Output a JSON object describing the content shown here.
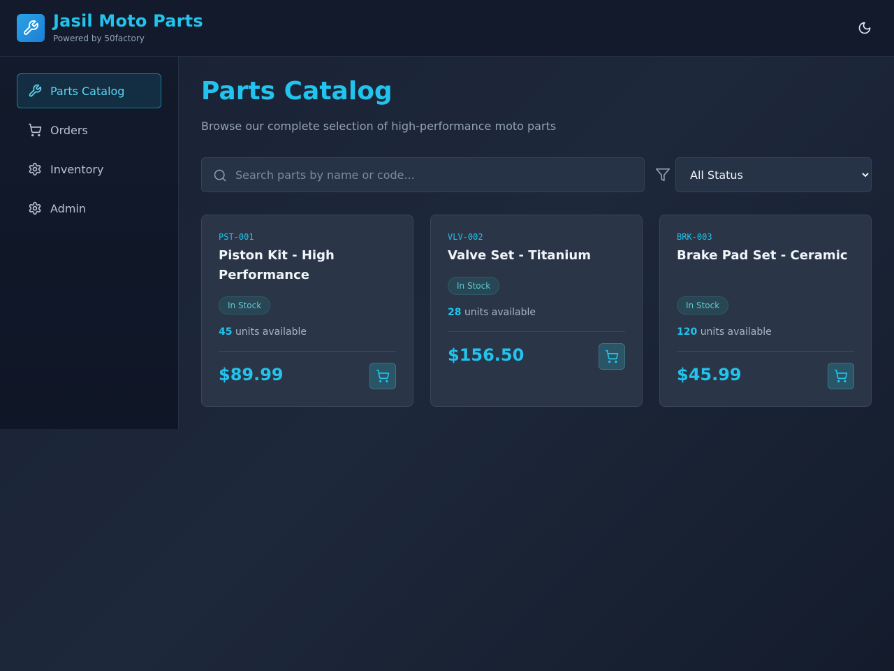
{
  "header": {
    "title": "Jasil Moto Parts",
    "subtitle": "Powered by 50factory"
  },
  "sidebar": {
    "items": [
      {
        "label": "Parts Catalog",
        "icon": "wrench-icon",
        "active": true
      },
      {
        "label": "Orders",
        "icon": "cart-icon",
        "active": false
      },
      {
        "label": "Inventory",
        "icon": "gear-icon",
        "active": false
      },
      {
        "label": "Admin",
        "icon": "gear-icon",
        "active": false
      }
    ]
  },
  "main": {
    "title": "Parts Catalog",
    "subtitle": "Browse our complete selection of high-performance moto parts",
    "search": {
      "placeholder": "Search parts by name or code...",
      "value": ""
    },
    "status_filter": {
      "selected": "All Status"
    },
    "products": [
      {
        "code": "PST-001",
        "name": "Piston Kit - High Performance",
        "status": "In Stock",
        "units": "45",
        "units_label": "units available",
        "price": "$89.99"
      },
      {
        "code": "VLV-002",
        "name": "Valve Set - Titanium",
        "status": "In Stock",
        "units": "28",
        "units_label": "units available",
        "price": "$156.50"
      },
      {
        "code": "BRK-003",
        "name": "Brake Pad Set - Ceramic",
        "status": "In Stock",
        "units": "120",
        "units_label": "units available",
        "price": "$45.99"
      }
    ]
  },
  "colors": {
    "accent": "#22c3ec",
    "background": "#1d283a",
    "card": "#2a3547",
    "badge": "#284653"
  }
}
